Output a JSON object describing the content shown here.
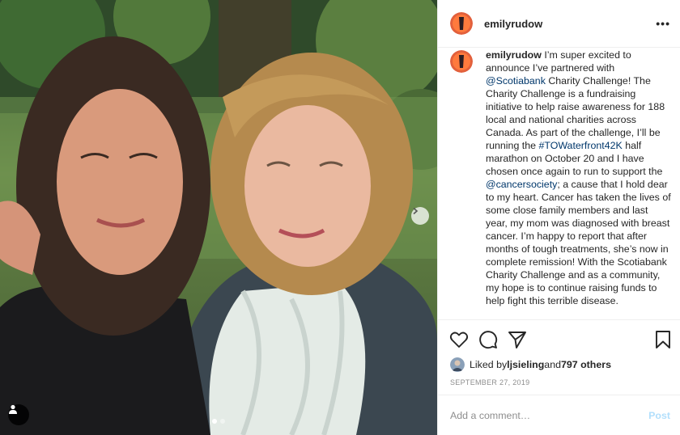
{
  "post": {
    "username": "emilyrudow",
    "more_label": "•••",
    "caption": {
      "username": "emilyrudow",
      "t1": "I’m super excited to announce I’ve partnered with ",
      "m1": "@Scotiabank",
      "t2": " Charity Challenge! The Charity Challenge is a fundraising initiative to help raise awareness for 188 local and national charities across Canada. As part of the challenge, I’ll be running the ",
      "h1": "#TOWaterfront42K",
      "t3": " half marathon on October 20 and I have chosen once again to run to support the ",
      "m2": "@cancersociety",
      "t4": "; a cause that I hold dear to my heart. Cancer has taken the lives of some close family members and last year, my mom was diagnosed with breast cancer. I’m happy to report that after months of tough treatments, she’s now in complete remission! With the Scotiabank Charity Challenge and as a community, my hope is to continue raising funds to help fight this terrible disease."
    },
    "likes": {
      "prefix": "Liked by ",
      "user": "ljsieling",
      "middle": " and ",
      "count": "797 others"
    },
    "date": "SEPTEMBER 27, 2019",
    "comment": {
      "placeholder": "Add a comment…",
      "post_label": "Post"
    },
    "icons": [
      "heart-icon",
      "comment-icon",
      "share-icon",
      "bookmark-icon",
      "user-tag-icon",
      "chevron-right-icon"
    ],
    "carousel": {
      "count": 2,
      "active": 0
    },
    "colors": {
      "link": "#00376b",
      "post_disabled": "#b2dffc",
      "muted": "#8e8e8e"
    }
  }
}
